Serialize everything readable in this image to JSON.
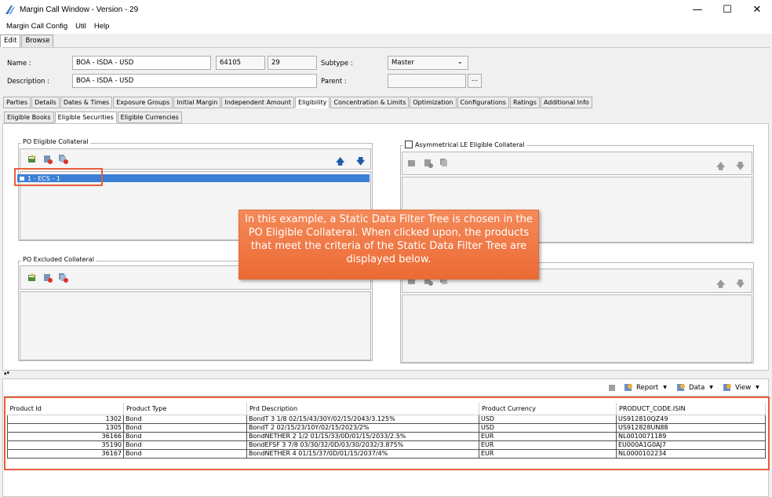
{
  "window": {
    "title": "Margin Call Window - Version - 29",
    "min": "—",
    "max": "☐",
    "close": "✕"
  },
  "menu": [
    "Margin Call Config",
    "Util",
    "Help"
  ],
  "mode_tabs": [
    "Edit",
    "Browse"
  ],
  "form": {
    "name_label": "Name :",
    "name_value": "BOA - ISDA - USD",
    "id_value": "64105",
    "version_value": "29",
    "subtype_label": "Subtype :",
    "subtype_value": "Master",
    "description_label": "Description :",
    "description_value": "BOA - ISDA - USD",
    "parent_label": "Parent :",
    "parent_value": "",
    "browse_button": "..."
  },
  "main_tabs": [
    "Parties",
    "Details",
    "Dates & Times",
    "Exposure Groups",
    "Initial Margin",
    "Independent Amount",
    "Eligibility",
    "Concentration & Limits",
    "Optimization",
    "Configurations",
    "Ratings",
    "Additional Info"
  ],
  "main_tab_active": "Eligibility",
  "sub_tabs": [
    "Eligible Books",
    "Eligible Securities",
    "Eligible Currencies"
  ],
  "sub_tab_active": "Eligible Securities",
  "groups": {
    "po_eligible": "PO Eligible Collateral",
    "asym_le_eligible": "Asymmetrical LE Eligible Collateral",
    "po_excluded": "PO Excluded Collateral"
  },
  "selected_item": "1 - ECS - 1",
  "callout_text": "In this example, a Static Data Filter Tree is chosen in the PO Eligible Collateral. When clicked upon, the products that meet the criteria of the Static Data Filter Tree are displayed below.",
  "bottom_menu": {
    "report": "Report",
    "data": "Data",
    "view": "View"
  },
  "table": {
    "columns": [
      "Product Id",
      "Product Type",
      "Prd Description",
      "Product Currency",
      "PRODUCT_CODE.ISIN"
    ],
    "rows": [
      [
        "1302",
        "Bond",
        "BondT 3 1/8 02/15/43/30Y/02/15/2043/3.125%",
        "USD",
        "US912810QZ49"
      ],
      [
        "1305",
        "Bond",
        "BondT 2 02/15/23/10Y/02/15/2023/2%",
        "USD",
        "US912828UN88"
      ],
      [
        "36166",
        "Bond",
        "BondNETHER 2 1/2 01/15/33/0D/01/15/2033/2.5%",
        "EUR",
        "NL0010071189"
      ],
      [
        "35190",
        "Bond",
        "BondEFSF 3 7/8 03/30/32/0D/03/30/2032/3.875%",
        "EUR",
        "EU000A1G0AJ7"
      ],
      [
        "36167",
        "Bond",
        "BondNETHER 4 01/15/37/0D/01/15/2037/4%",
        "EUR",
        "NL0000102234"
      ]
    ]
  }
}
